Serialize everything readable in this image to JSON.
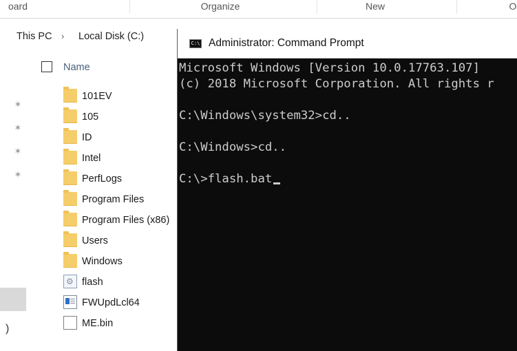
{
  "ribbon": {
    "groups": [
      "oard",
      "Organize",
      "New",
      "O"
    ]
  },
  "breadcrumb": {
    "items": [
      "This PC",
      "Local Disk (C:)"
    ],
    "separator_icon": "chevron-right-icon"
  },
  "file_list": {
    "column_name": "Name",
    "items": [
      {
        "name": "101EV",
        "icon": "folder-icon"
      },
      {
        "name": "105",
        "icon": "folder-icon"
      },
      {
        "name": "ID",
        "icon": "folder-icon"
      },
      {
        "name": "Intel",
        "icon": "folder-icon"
      },
      {
        "name": "PerfLogs",
        "icon": "folder-icon"
      },
      {
        "name": "Program Files",
        "icon": "folder-icon"
      },
      {
        "name": "Program Files (x86)",
        "icon": "folder-icon"
      },
      {
        "name": "Users",
        "icon": "folder-icon"
      },
      {
        "name": "Windows",
        "icon": "folder-icon"
      },
      {
        "name": "flash",
        "icon": "batch-file-icon"
      },
      {
        "name": "FWUpdLcl64",
        "icon": "executable-icon"
      },
      {
        "name": "ME.bin",
        "icon": "file-icon"
      }
    ]
  },
  "nav_pane": {
    "pins": 4,
    "partial_text": ")"
  },
  "command_prompt": {
    "title": "Administrator: Command Prompt",
    "icon_text": "C:\\",
    "lines": [
      "Microsoft Windows [Version 10.0.17763.107]",
      "(c) 2018 Microsoft Corporation. All rights r",
      "",
      "C:\\Windows\\system32>cd..",
      "",
      "C:\\Windows>cd..",
      "",
      "C:\\>flash.bat"
    ]
  },
  "colors": {
    "terminal_bg": "#0c0c0c",
    "terminal_fg": "#cccccc",
    "folder": "#f5cd6a"
  }
}
